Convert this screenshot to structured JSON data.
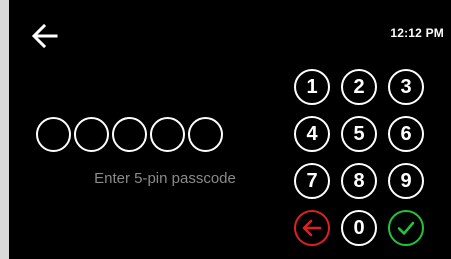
{
  "status_bar": {
    "time": "12:12 PM"
  },
  "back": {
    "icon": "arrow-left-icon",
    "color": "#ffffff"
  },
  "pin": {
    "length": 5,
    "entered": 0,
    "prompt": "Enter 5-pin passcode"
  },
  "keypad": {
    "keys": [
      {
        "label": "1"
      },
      {
        "label": "2"
      },
      {
        "label": "3"
      },
      {
        "label": "4"
      },
      {
        "label": "5"
      },
      {
        "label": "6"
      },
      {
        "label": "7"
      },
      {
        "label": "8"
      },
      {
        "label": "9"
      },
      {
        "label": "",
        "icon": "backspace-arrow-icon",
        "color": "#e02020"
      },
      {
        "label": "0"
      },
      {
        "label": "",
        "icon": "checkmark-icon",
        "color": "#22c43a"
      }
    ]
  }
}
